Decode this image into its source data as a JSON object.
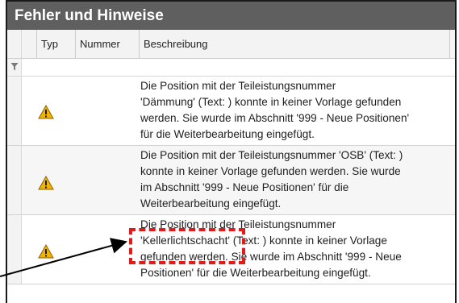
{
  "panel": {
    "title": "Fehler und Hinweise"
  },
  "columns": [
    {
      "label": "Typ"
    },
    {
      "label": "Nummer"
    },
    {
      "label": "Beschreibung"
    }
  ],
  "rows": [
    {
      "type_icon": "warning-triangle-icon",
      "number": "",
      "description": "Die Position mit der Teileistungsnummer\n'Dämmung' (Text: ) konnte in keiner Vorlage gefunden\nwerden. Sie wurde im Abschnitt '999 - Neue Positionen'\nfür die Weiterbearbeitung eingefügt."
    },
    {
      "type_icon": "warning-triangle-icon",
      "number": "",
      "description": "Die Position mit der Teileistungsnummer 'OSB' (Text: )\nkonnte in keiner Vorlage gefunden werden. Sie wurde\nim Abschnitt '999 - Neue Positionen' für die\nWeiterbearbeitung eingefügt."
    },
    {
      "type_icon": "warning-triangle-icon",
      "number": "",
      "description": "Die Position mit der Teileistungsnummer\n'Kellerlichtschacht' (Text: ) konnte in keiner Vorlage\ngefunden werden. Sie wurde im Abschnitt '999 - Neue\nPositionen' für die Weiterbearbeitung eingefügt."
    }
  ],
  "colors": {
    "title_bar": "#5f5f5f",
    "warning_fill": "#f2b400",
    "annotation": "#e21a1a"
  }
}
